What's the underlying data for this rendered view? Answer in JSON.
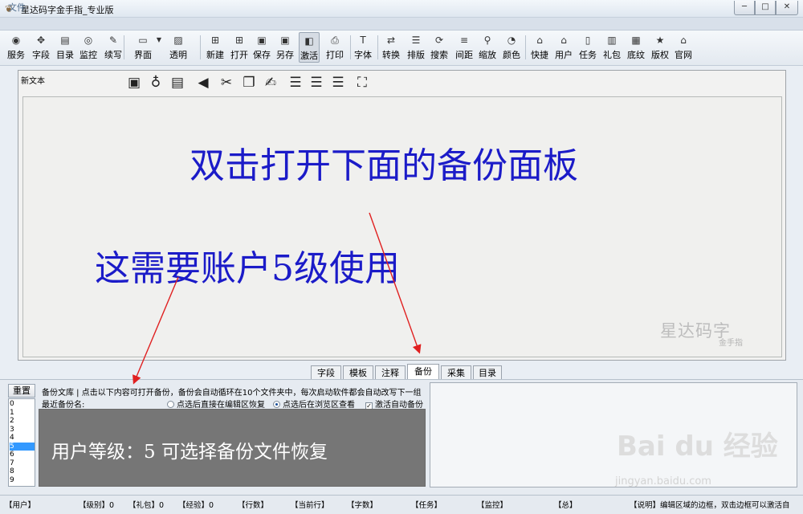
{
  "window": {
    "title": "星达码字金手指_专业版",
    "icon": "bird-icon",
    "minimize": "─",
    "maximize": "□",
    "close": "✕"
  },
  "menu": {
    "file": "文件"
  },
  "toolbar": {
    "items": [
      {
        "label": "服务",
        "icon": "rss-icon",
        "glyph": "◉"
      },
      {
        "label": "字段",
        "icon": "move-icon",
        "glyph": "✥"
      },
      {
        "label": "目录",
        "icon": "book-icon",
        "glyph": "▤"
      },
      {
        "label": "监控",
        "icon": "monitor-icon",
        "glyph": "◎"
      },
      {
        "label": "续写",
        "icon": "pen-icon",
        "glyph": "✎"
      },
      {
        "label": "界面",
        "icon": "window-icon",
        "glyph": "▭"
      },
      {
        "label": "透明",
        "icon": "image-icon",
        "glyph": "▨"
      },
      {
        "label": "新建",
        "icon": "new-icon",
        "glyph": "⊞"
      },
      {
        "label": "打开",
        "icon": "open-icon",
        "glyph": "⊞"
      },
      {
        "label": "保存",
        "icon": "save-icon",
        "glyph": "▣"
      },
      {
        "label": "另存",
        "icon": "save-as-icon",
        "glyph": "▣"
      },
      {
        "label": "激活",
        "icon": "activate-icon",
        "glyph": "◧"
      },
      {
        "label": "打印",
        "icon": "print-icon",
        "glyph": "⎙"
      },
      {
        "label": "字体",
        "icon": "font-icon",
        "glyph": "T"
      },
      {
        "label": "转换",
        "icon": "convert-icon",
        "glyph": "⇄"
      },
      {
        "label": "排版",
        "icon": "layout-icon",
        "glyph": "☰"
      },
      {
        "label": "搜索",
        "icon": "search-icon",
        "glyph": "⟳"
      },
      {
        "label": "间距",
        "icon": "spacing-icon",
        "glyph": "≡"
      },
      {
        "label": "缩放",
        "icon": "zoom-icon",
        "glyph": "⚲"
      },
      {
        "label": "颜色",
        "icon": "color-icon",
        "glyph": "◔"
      },
      {
        "label": "快捷",
        "icon": "shortcut-icon",
        "glyph": "⌂"
      },
      {
        "label": "用户",
        "icon": "user-icon",
        "glyph": "⌂"
      },
      {
        "label": "任务",
        "icon": "task-icon",
        "glyph": "▯"
      },
      {
        "label": "礼包",
        "icon": "gift-icon",
        "glyph": "▥"
      },
      {
        "label": "底纹",
        "icon": "texture-icon",
        "glyph": "▦"
      },
      {
        "label": "版权",
        "icon": "star-icon",
        "glyph": "★"
      },
      {
        "label": "官网",
        "icon": "home-icon",
        "glyph": "⌂"
      }
    ]
  },
  "editor": {
    "file_label": "新文本",
    "heading1": "双击打开下面的备份面板",
    "heading2": "这需要账户5级使用",
    "watermark": "星达码字",
    "watermark_sub": "金手指"
  },
  "tabs": [
    {
      "label": "字段",
      "active": false
    },
    {
      "label": "模板",
      "active": false
    },
    {
      "label": "注释",
      "active": false
    },
    {
      "label": "备份",
      "active": true
    },
    {
      "label": "采集",
      "active": false
    },
    {
      "label": "目录",
      "active": false
    }
  ],
  "backup": {
    "reset": "重置",
    "slots": [
      "0",
      "1",
      "2",
      "3",
      "4",
      "5",
      "6",
      "7",
      "8",
      "9"
    ],
    "selected_slot": "5",
    "description": "备份文库 | 点击以下内容可打开备份，备份会自动循环在10个文件夹中，每次启动软件都会自动改写下一组",
    "recent_label": "最近备份名:",
    "radio_restore": "点选后直接在编辑区恢复",
    "radio_browse": "点选后在浏览区查看",
    "radio_selected": "browse",
    "auto_backup": "激活自动备份",
    "auto_backup_checked": true,
    "preview": "用户等级：5 可选择备份文件恢复"
  },
  "status": {
    "user": "【用户】",
    "level": "【级别】0",
    "gift": "【礼包】0",
    "exp": "【经验】0",
    "lines": "【行数】",
    "current_line": "【当前行】",
    "chars": "【字数】",
    "task": "【任务】",
    "monitor": "【监控】",
    "total": "【总】",
    "note": "【说明】编辑区域的边框，双击边框可以激活自"
  },
  "overlay": {
    "baidu": "Bai du 经验",
    "baidu_url": "jingyan.baidu.com",
    "annotation_color": "#e02020",
    "heading_color": "#1b1bc8"
  }
}
